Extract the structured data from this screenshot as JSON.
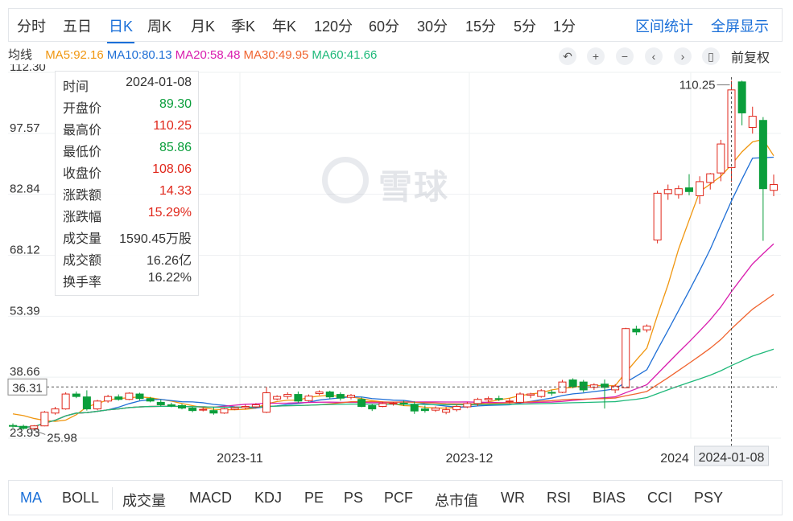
{
  "periods": {
    "items": [
      "分时",
      "五日",
      "日K",
      "周K",
      "月K",
      "季K",
      "年K",
      "120分",
      "60分",
      "30分",
      "15分",
      "5分",
      "1分"
    ],
    "active": "日K",
    "range_stats": "区间统计",
    "fullscreen": "全屏显示"
  },
  "ma_legend": {
    "label": "均线",
    "items": [
      {
        "text": "MA5:92.16",
        "color": "#f0960f"
      },
      {
        "text": "MA10:80.13",
        "color": "#1f6fd6"
      },
      {
        "text": "MA20:58.48",
        "color": "#d91dae"
      },
      {
        "text": "MA30:49.95",
        "color": "#f0642f"
      },
      {
        "text": "MA60:41.66",
        "color": "#1fb97a"
      }
    ]
  },
  "controls": {
    "icons": [
      "undo-icon",
      "zoom-in-icon",
      "zoom-out-icon",
      "scroll-left-icon",
      "scroll-right-icon",
      "candle-type-icon"
    ],
    "adjust_label": "前复权"
  },
  "info_panel": {
    "rows": [
      {
        "k": "时间",
        "v": "2024-01-08",
        "c": "#333333"
      },
      {
        "k": "开盘价",
        "v": "89.30",
        "c": "#0a9e3b"
      },
      {
        "k": "最高价",
        "v": "110.25",
        "c": "#e0271b"
      },
      {
        "k": "最低价",
        "v": "85.86",
        "c": "#0a9e3b"
      },
      {
        "k": "收盘价",
        "v": "108.06",
        "c": "#e0271b"
      },
      {
        "k": "涨跌额",
        "v": "14.33",
        "c": "#e0271b"
      },
      {
        "k": "涨跌幅",
        "v": "15.29%",
        "c": "#e0271b"
      },
      {
        "k": "成交量",
        "v": "1590.45万股",
        "c": "#333333"
      },
      {
        "k": "成交额",
        "v": "16.26亿",
        "c": "#333333"
      },
      {
        "k": "换手率",
        "v": "16.22%",
        "c": "#333333"
      }
    ]
  },
  "watermark": {
    "text": "雪球"
  },
  "indicators": {
    "items": [
      "MA",
      "BOLL",
      "成交量",
      "MACD",
      "KDJ",
      "PE",
      "PS",
      "PCF",
      "总市值",
      "WR",
      "RSI",
      "BIAS",
      "CCI",
      "PSY"
    ],
    "active": "MA"
  },
  "chart_data": {
    "type": "candlestick",
    "y_ticks": [
      "112.30",
      "97.57",
      "82.84",
      "68.12",
      "53.39",
      "38.66",
      "23.93"
    ],
    "ylim": [
      23.93,
      112.3
    ],
    "x_tick_labels": [
      "2023-11",
      "2023-12",
      "2024"
    ],
    "crosshair": {
      "date": "2024-01-08",
      "price_label": "36.31",
      "price": 36.31
    },
    "high_marker": "110.25",
    "low_marker": "25.98",
    "colors": {
      "up": "#e0271b",
      "down": "#0a9e3b"
    },
    "candles": [
      [
        null,
        27,
        27.5,
        26.4,
        26.9
      ],
      [
        null,
        26.8,
        27.2,
        26.0,
        26.3
      ],
      [
        null,
        26.3,
        27.1,
        25.98,
        26.9
      ],
      [
        null,
        26.9,
        30.5,
        26.8,
        30.2
      ],
      [
        null,
        30.0,
        31.5,
        29.6,
        31.0
      ],
      [
        null,
        31.0,
        35.0,
        30.8,
        34.6
      ],
      [
        null,
        34.6,
        35.2,
        33.6,
        34.0
      ],
      [
        null,
        33.9,
        35.5,
        30.6,
        31.0
      ],
      [
        null,
        31.0,
        33.2,
        30.7,
        32.9
      ],
      [
        null,
        32.9,
        34.4,
        32.5,
        34.0
      ],
      [
        null,
        33.9,
        34.5,
        33.0,
        33.3
      ],
      [
        null,
        33.3,
        35.0,
        33.1,
        34.8
      ],
      [
        null,
        34.6,
        34.9,
        33.1,
        33.5
      ],
      [
        null,
        33.5,
        33.9,
        32.6,
        32.9
      ],
      [
        null,
        32.6,
        33.2,
        31.6,
        32.0
      ],
      [
        null,
        32.0,
        32.5,
        31.4,
        31.7
      ],
      [
        null,
        31.8,
        32.2,
        30.9,
        31.2
      ],
      [
        null,
        31.2,
        31.5,
        30.2,
        30.6
      ],
      [
        null,
        30.7,
        31.4,
        30.4,
        30.9
      ],
      [
        null,
        30.6,
        31.4,
        29.6,
        30.0
      ],
      [
        null,
        30.0,
        31.2,
        29.8,
        31.0
      ],
      [
        null,
        30.9,
        31.6,
        30.7,
        31.3
      ],
      [
        null,
        31.3,
        32.0,
        30.9,
        31.6
      ],
      [
        null,
        31.5,
        32.4,
        31.2,
        32.0
      ],
      [
        null,
        30.2,
        36.3,
        30.0,
        34.9
      ],
      [
        null,
        33.4,
        34.3,
        33.1,
        34.0
      ],
      [
        null,
        34.0,
        35.0,
        33.4,
        34.5
      ],
      [
        null,
        34.5,
        35.2,
        32.5,
        32.9
      ],
      [
        null,
        33.0,
        34.5,
        32.8,
        34.1
      ],
      [
        null,
        34.7,
        35.5,
        34.3,
        35.1
      ],
      [
        null,
        35.1,
        35.4,
        33.4,
        33.9
      ],
      [
        null,
        34.5,
        35.0,
        33.0,
        33.6
      ],
      [
        null,
        33.8,
        34.6,
        33.3,
        34.3
      ],
      [
        null,
        33.3,
        33.9,
        31.4,
        31.6
      ],
      [
        null,
        31.8,
        32.2,
        30.5,
        31.0
      ],
      [
        null,
        31.6,
        32.7,
        31.4,
        32.3
      ],
      [
        null,
        32.2,
        32.7,
        31.8,
        32.4
      ],
      [
        null,
        32.4,
        33.0,
        31.7,
        32.2
      ],
      [
        null,
        32.1,
        32.8,
        29.8,
        30.5
      ],
      [
        null,
        31.0,
        31.8,
        30.1,
        30.6
      ],
      [
        null,
        30.7,
        31.6,
        30.3,
        31.2
      ],
      [
        null,
        30.2,
        31.5,
        29.7,
        30.8
      ],
      [
        null,
        30.8,
        32.0,
        30.4,
        31.6
      ],
      [
        null,
        31.5,
        32.7,
        31.2,
        32.3
      ],
      [
        null,
        32.3,
        33.7,
        31.7,
        33.3
      ],
      [
        null,
        33.2,
        34.0,
        32.6,
        33.5
      ],
      [
        null,
        33.5,
        34.2,
        32.9,
        33.3
      ],
      [
        null,
        32.9,
        33.6,
        32.3,
        32.9
      ],
      [
        null,
        32.6,
        35.0,
        32.4,
        34.6
      ],
      [
        null,
        34.3,
        34.9,
        33.6,
        34.6
      ],
      [
        null,
        34.0,
        35.8,
        33.7,
        35.4
      ],
      [
        null,
        35.0,
        35.6,
        34.2,
        34.8
      ],
      [
        null,
        35.0,
        38.0,
        34.8,
        37.5
      ],
      [
        null,
        38.0,
        38.4,
        36.0,
        36.4
      ],
      [
        null,
        37.5,
        38.0,
        35.0,
        35.6
      ],
      [
        null,
        36.2,
        37.2,
        35.6,
        36.8
      ],
      [
        null,
        37.0,
        38.1,
        31.1,
        36.2
      ],
      [
        null,
        35.6,
        37.0,
        34.8,
        36.5
      ],
      [
        null,
        36.1,
        50.6,
        36.0,
        50.4
      ],
      [
        null,
        50.3,
        51.1,
        48.8,
        49.6
      ],
      [
        null,
        50.1,
        51.4,
        49.5,
        51.0
      ],
      [
        null,
        71.8,
        83.7,
        71.0,
        83.1
      ],
      [
        null,
        83.0,
        85.2,
        81.5,
        84.0
      ],
      [
        null,
        82.8,
        85.0,
        81.8,
        84.2
      ],
      [
        null,
        84.4,
        87.7,
        82.6,
        83.5
      ],
      [
        null,
        82.5,
        87.2,
        80.5,
        85.9
      ],
      [
        null,
        85.7,
        88.0,
        84.0,
        87.8
      ],
      [
        null,
        88.0,
        96.0,
        86.0,
        95.0
      ],
      [
        null,
        89.3,
        110.25,
        85.86,
        108.06
      ],
      [
        null,
        110.0,
        110.3,
        99.5,
        102.5
      ],
      [
        null,
        99.0,
        104.0,
        97.5,
        101.7
      ],
      [
        null,
        100.7,
        101.5,
        71.6,
        84.2
      ],
      [
        null,
        83.8,
        87.6,
        82.4,
        85.2
      ]
    ],
    "ma_series": {
      "MA5": [
        29.8,
        29.4,
        28.7,
        28.2,
        28.0,
        28.3,
        29.6,
        31.5,
        32.3,
        33.2,
        33.5,
        33.7,
        33.9,
        33.7,
        33.3,
        32.9,
        32.3,
        31.8,
        31.3,
        30.9,
        30.8,
        30.8,
        30.9,
        31.2,
        32.2,
        32.8,
        33.1,
        33.1,
        33.8,
        34.1,
        34.3,
        34.0,
        33.9,
        33.5,
        33.0,
        32.7,
        32.2,
        31.8,
        31.7,
        31.4,
        31.2,
        31.2,
        31.3,
        31.7,
        32.3,
        32.7,
        33.2,
        33.6,
        34.2,
        34.6,
        34.9,
        35.6,
        36.0,
        36.2,
        36.6,
        36.7,
        36.6,
        36.6,
        39.8,
        42.8,
        45.7,
        53.6,
        61.0,
        69.6,
        76.6,
        83.5,
        85.3,
        87.2,
        90.0,
        93.1,
        95.5,
        96.1,
        92.16
      ]
    }
  }
}
